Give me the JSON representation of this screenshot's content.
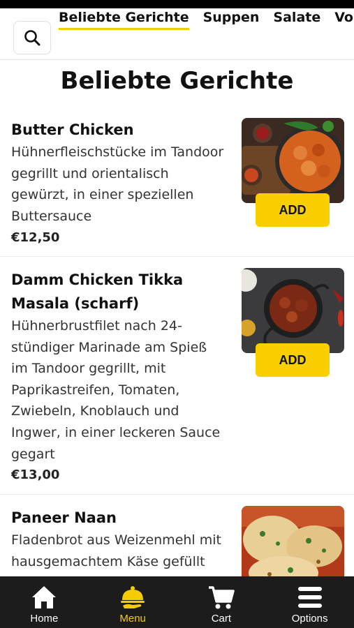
{
  "categories": {
    "tabs": [
      {
        "label": "Beliebte Gerichte",
        "active": true
      },
      {
        "label": "Suppen",
        "active": false
      },
      {
        "label": "Salate",
        "active": false
      },
      {
        "label": "Vorsp",
        "active": false
      }
    ]
  },
  "search": {
    "icon": "search-icon"
  },
  "section": {
    "title": "Beliebte Gerichte"
  },
  "items": [
    {
      "name": "Butter Chicken",
      "description": [
        "Hühnerfleischstücke im Tandoor",
        "gegrillt und orientalisch",
        "gewürzt, in einer speziellen",
        "Buttersauce"
      ],
      "price": "€12,50",
      "add_label": "ADD"
    },
    {
      "name": [
        "Damm Chicken Tikka",
        "Masala (scharf)"
      ],
      "description": [
        "Hühnerbrustfilet nach 24-",
        "stündiger Marinade am Spieß",
        "im Tandoor gegrillt, mit",
        "Paprikastreifen, Tomaten,",
        "Zwiebeln, Knoblauch und",
        "Ingwer, in einer leckeren Sauce",
        "gegart"
      ],
      "price": "€13,00",
      "add_label": "ADD"
    },
    {
      "name": "Paneer Naan",
      "description": [
        "Fladenbrot aus Weizenmehl mit",
        "hausgemachtem Käse gefüllt"
      ]
    }
  ],
  "nav": {
    "items": [
      {
        "label": "Home",
        "icon": "home-icon",
        "active": false
      },
      {
        "label": "Menu",
        "icon": "cloche-icon",
        "active": true
      },
      {
        "label": "Cart",
        "icon": "cart-icon",
        "active": false
      },
      {
        "label": "Options",
        "icon": "menu-icon",
        "active": false
      }
    ]
  },
  "colors": {
    "accent": "#f9cf00",
    "nav_bg": "#1c1c1c",
    "text": "#111111"
  }
}
